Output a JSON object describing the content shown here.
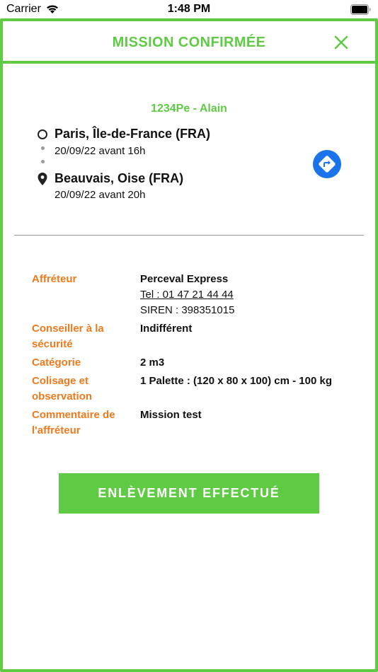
{
  "status_bar": {
    "carrier": "Carrier",
    "time": "1:48 PM"
  },
  "header": {
    "title": "MISSION CONFIRMÉE",
    "close_icon": "close-icon"
  },
  "mission": {
    "reference": "1234Pe - Alain",
    "pickup": {
      "place": "Paris, Île-de-France (FRA)",
      "when": "20/09/22 avant 16h",
      "icon": "circle-icon"
    },
    "delivery": {
      "place": "Beauvais, Oise (FRA)",
      "when": "20/09/22 avant 20h",
      "icon": "pin-icon"
    },
    "route_icon": "directions-icon"
  },
  "details": {
    "affreteur": {
      "label": "Affréteur",
      "name": "Perceval Express",
      "phone": "Tel : 01 47 21 44 44",
      "siren": "SIREN : 398351015"
    },
    "conseiller": {
      "label_line1": "Conseiller à la",
      "label_line2": "sécurité",
      "value": "Indifférent"
    },
    "categorie": {
      "label": "Catégorie",
      "value": "2 m3"
    },
    "colisage": {
      "label_line1": "Colisage et",
      "label_line2": "observation",
      "value": "1 Palette : (120 x 80 x 100) cm - 100 kg"
    },
    "commentaire": {
      "label_line1": "Commentaire de",
      "label_line2": "l'affréteur",
      "value": "Mission test"
    }
  },
  "action": {
    "label": "ENLÈVEMENT EFFECTUÉ"
  },
  "colors": {
    "accent_green": "#5fcb45",
    "label_orange": "#ee7a1d",
    "route_blue": "#1a73e8"
  }
}
